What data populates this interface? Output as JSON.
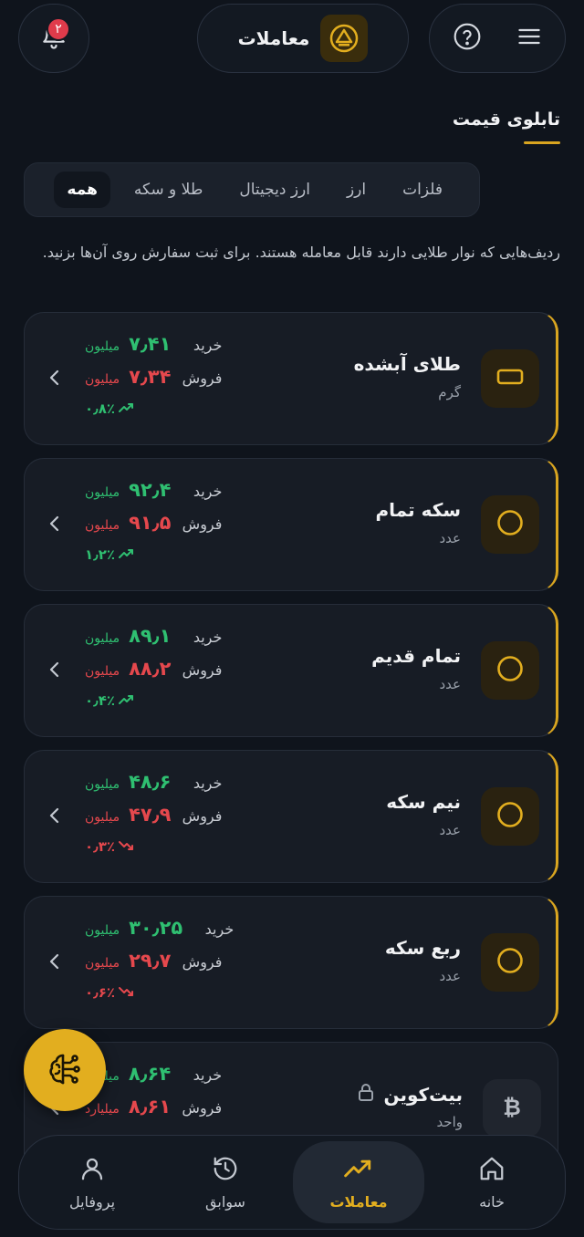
{
  "header": {
    "notification_count": "۲",
    "title": "معاملات"
  },
  "page": {
    "title": "تابلوی قیمت",
    "info": "ردیف‌هایی که نوار طلایی دارند قابل معامله هستند. برای ثبت سفارش روی آن‌ها بزنید."
  },
  "tabs": [
    {
      "label": "همه",
      "active": true
    },
    {
      "label": "طلا و سکه"
    },
    {
      "label": "ارز دیجیتال"
    },
    {
      "label": "ارز"
    },
    {
      "label": "فلزات"
    }
  ],
  "labels": {
    "buy": "خرید",
    "sell": "فروش"
  },
  "assets": [
    {
      "name": "طلای آبشده",
      "unit": "گرم",
      "buy": "۷٫۴۱",
      "buy_unit": "میلیون",
      "sell": "۷٫۳۴",
      "sell_unit": "میلیون",
      "change": "۰٫۸٪",
      "direction": "up",
      "icon": "gold-bar-icon"
    },
    {
      "name": "سکه تمام",
      "unit": "عدد",
      "buy": "۹۲٫۴",
      "buy_unit": "میلیون",
      "sell": "۹۱٫۵",
      "sell_unit": "میلیون",
      "change": "۱٫۲٪",
      "direction": "up",
      "icon": "coin-icon"
    },
    {
      "name": "تمام قدیم",
      "unit": "عدد",
      "buy": "۸۹٫۱",
      "buy_unit": "میلیون",
      "sell": "۸۸٫۲",
      "sell_unit": "میلیون",
      "change": "۰٫۴٪",
      "direction": "up",
      "icon": "coin-icon"
    },
    {
      "name": "نیم سکه",
      "unit": "عدد",
      "buy": "۴۸٫۶",
      "buy_unit": "میلیون",
      "sell": "۴۷٫۹",
      "sell_unit": "میلیون",
      "change": "۰٫۳٪",
      "direction": "down",
      "icon": "coin-icon"
    },
    {
      "name": "ربع سکه",
      "unit": "عدد",
      "buy": "۳۰٫۲۵",
      "buy_unit": "میلیون",
      "sell": "۲۹٫۷",
      "sell_unit": "میلیون",
      "change": "۰٫۶٪",
      "direction": "down",
      "icon": "coin-icon"
    },
    {
      "name": "بیت‌کوین",
      "unit": "واحد",
      "buy": "۸٫۶۴",
      "buy_unit": "میلیارد",
      "sell": "۸٫۶۱",
      "sell_unit": "میلیارد",
      "change": "",
      "direction": "up",
      "icon": "bitcoin-icon",
      "locked": true
    }
  ],
  "nav": [
    {
      "label": "خانه",
      "icon": "home-icon"
    },
    {
      "label": "معاملات",
      "icon": "trending-up-icon",
      "active": true
    },
    {
      "label": "سوابق",
      "icon": "history-icon"
    },
    {
      "label": "پروفایل",
      "icon": "user-icon"
    }
  ],
  "colors": {
    "accent": "#e2ae1f",
    "buy": "#2fbf71",
    "sell": "#e5484d",
    "background": "#0f141c"
  }
}
